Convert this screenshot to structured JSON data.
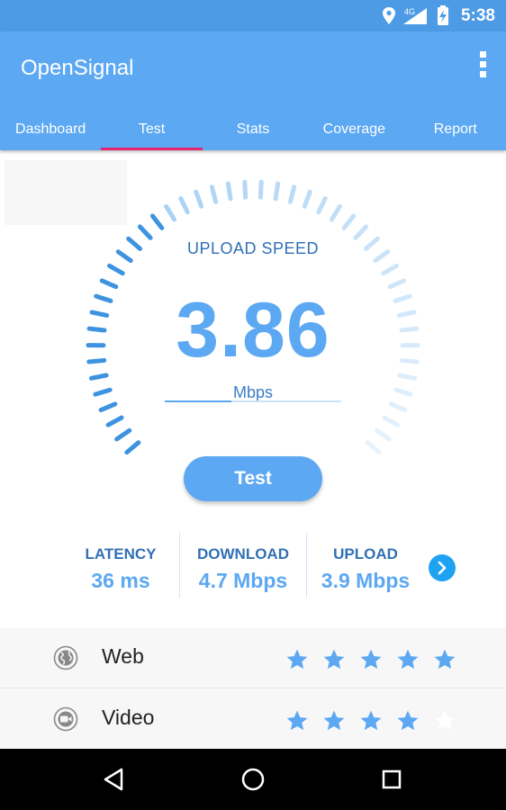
{
  "status_bar": {
    "time": "5:38",
    "network": "4G",
    "icons": [
      "location-icon",
      "signal-icon",
      "battery-charging-icon"
    ]
  },
  "app_bar": {
    "title": "OpenSignal",
    "menu_icon": "overflow-menu-icon"
  },
  "tabs": [
    {
      "label": "Dashboard",
      "active": false
    },
    {
      "label": "Test",
      "active": true
    },
    {
      "label": "Stats",
      "active": false
    },
    {
      "label": "Coverage",
      "active": false
    },
    {
      "label": "Report",
      "active": false
    }
  ],
  "gauge": {
    "label": "UPLOAD SPEED",
    "value": "3.86",
    "unit": "Mbps",
    "progress_fraction": 0.38
  },
  "test_button": {
    "label": "Test"
  },
  "results": [
    {
      "label": "LATENCY",
      "value": "36 ms"
    },
    {
      "label": "DOWNLOAD",
      "value": "4.7 Mbps"
    },
    {
      "label": "UPLOAD",
      "value": "3.9 Mbps"
    }
  ],
  "ratings": [
    {
      "label": "Web",
      "icon": "globe-icon",
      "stars": 5,
      "max": 5
    },
    {
      "label": "Video",
      "icon": "video-icon",
      "stars": 4,
      "max": 5
    }
  ],
  "nav": {
    "icons": [
      "back-icon",
      "home-icon",
      "recents-icon"
    ]
  },
  "colors": {
    "primary": "#5CA8F2",
    "status_bar": "#4C9BE4",
    "tab_indicator": "#E5246F",
    "accent": "#1EA3F3",
    "label_dark": "#3170B5"
  }
}
